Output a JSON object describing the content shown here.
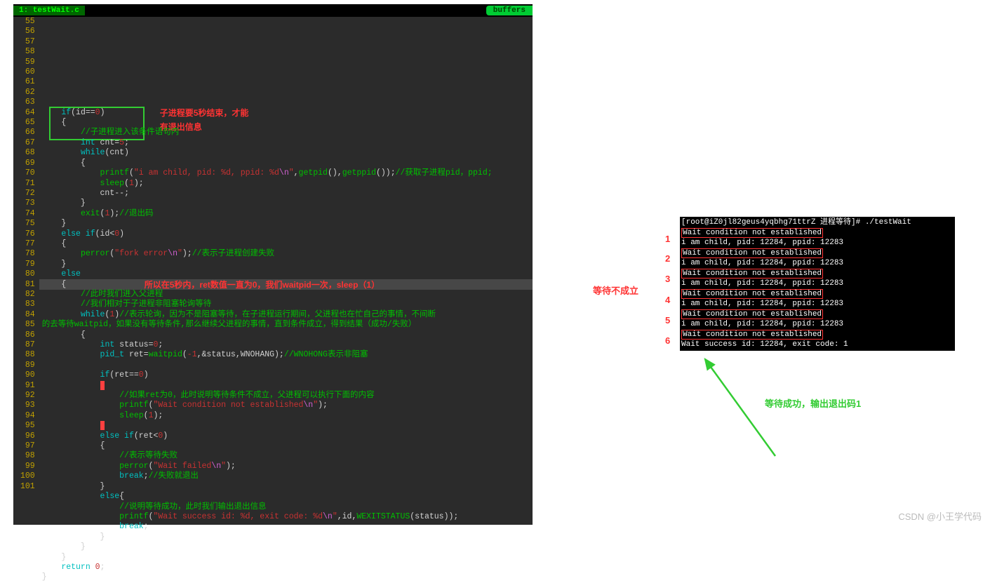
{
  "editor": {
    "tab_label": "1: testWait.c",
    "buffers_label": "buffers",
    "line_start": 55,
    "lines": [
      "    if(id==0)",
      "    {",
      "        //子进程进入该条件语句内",
      "        int cnt=5;",
      "        while(cnt)",
      "        {",
      "            printf(\"i am child, pid: %d, ppid: %d\\n\",getpid(),getppid());//获取子进程pid，ppid;",
      "            sleep(1);",
      "            cnt--;",
      "        }",
      "        exit(1);//退出码",
      "    }",
      "    else if(id<0)",
      "    {",
      "        perror(\"fork error\\n\");//表示子进程创建失败",
      "    }",
      "    else",
      "    {",
      "        //此时我们进入父进程",
      "        //我们相对于子进程非阻塞轮询等待",
      "        while(1)//表示轮询，因为不是阻塞等待，在子进程运行期间，父进程也在忙自己的事情，不间断",
      "的去等待waitpid，如果没有等待条件,那么继续父进程的事情，直到条件成立，得到结果（成功/失败）",
      "        {",
      "            int status=0;",
      "            pid_t ret=waitpid(-1,&status,WNOHANG);//WNOHONG表示非阻塞",
      "",
      "            if(ret==0)",
      "            {",
      "                //如果ret为0，此时说明等待条件不成立，父进程可以执行下面的内容",
      "                printf(\"Wait condition not established\\n\");",
      "                sleep(1);",
      "            }",
      "            else if(ret<0)",
      "            {",
      "                //表示等待失败",
      "                perror(\"Wait failed\\n\");",
      "                break;//失败就退出",
      "            }",
      "            else{",
      "                //说明等待成功，此时我们输出退出信息",
      "                printf(\"Wait success id: %d, exit code: %d\\n\",id,WEXITSTATUS(status));",
      "                break;",
      "            }",
      "        }",
      "    }",
      "    return 0;",
      "}"
    ],
    "annotations": {
      "box1_label_line1": "子进程要5秒结束，才能",
      "box1_label_line2": "有退出信息",
      "red_inline": "所以在5秒内，ret数值一直为0，我们waitpid一次，sleep（1）"
    }
  },
  "terminal": {
    "prompt": "[root@iZ0jl82geus4yqbhg71ttrZ 进程等待]# ./testWait",
    "wait_line": "Wait condition not established",
    "child_line": "i am child, pid: 12284, ppid: 12283",
    "success_line": "Wait success id: 12284, exit code: 1"
  },
  "right_annotations": {
    "red_label": "等待不成立",
    "green_label": "等待成功，输出退出码1",
    "numbers": [
      "1",
      "2",
      "3",
      "4",
      "5",
      "6"
    ]
  },
  "watermark": "CSDN @小王学代码"
}
